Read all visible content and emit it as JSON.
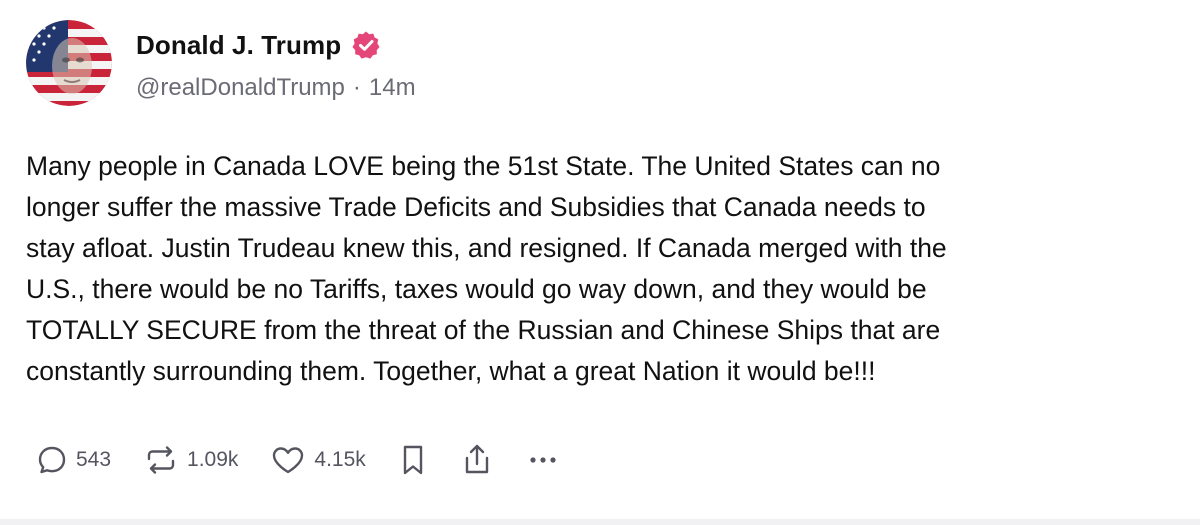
{
  "author": {
    "display_name": "Donald J. Trump",
    "handle": "@realDonaldTrump",
    "separator": "·",
    "time_ago": "14m",
    "avatar_icon": "flag-portrait-avatar",
    "verified_icon": "verified-badge-icon",
    "verified_color": "#e5467a"
  },
  "post": {
    "text": "Many people in Canada LOVE being the 51st State. The United States can no\nlonger suffer the massive Trade Deficits and Subsidies that Canada needs to\nstay afloat. Justin Trudeau knew this, and resigned. If Canada merged with the\nU.S., there would be no Tariffs, taxes would go way down, and they would be\nTOTALLY SECURE from the threat of the Russian and Chinese Ships that are\nconstantly surrounding them. Together, what a great Nation it would be!!!"
  },
  "actions": {
    "replies": "543",
    "reposts": "1.09k",
    "likes": "4.15k",
    "icons": [
      "comment-icon",
      "repost-icon",
      "heart-icon",
      "bookmark-icon",
      "share-icon",
      "more-icon"
    ]
  }
}
